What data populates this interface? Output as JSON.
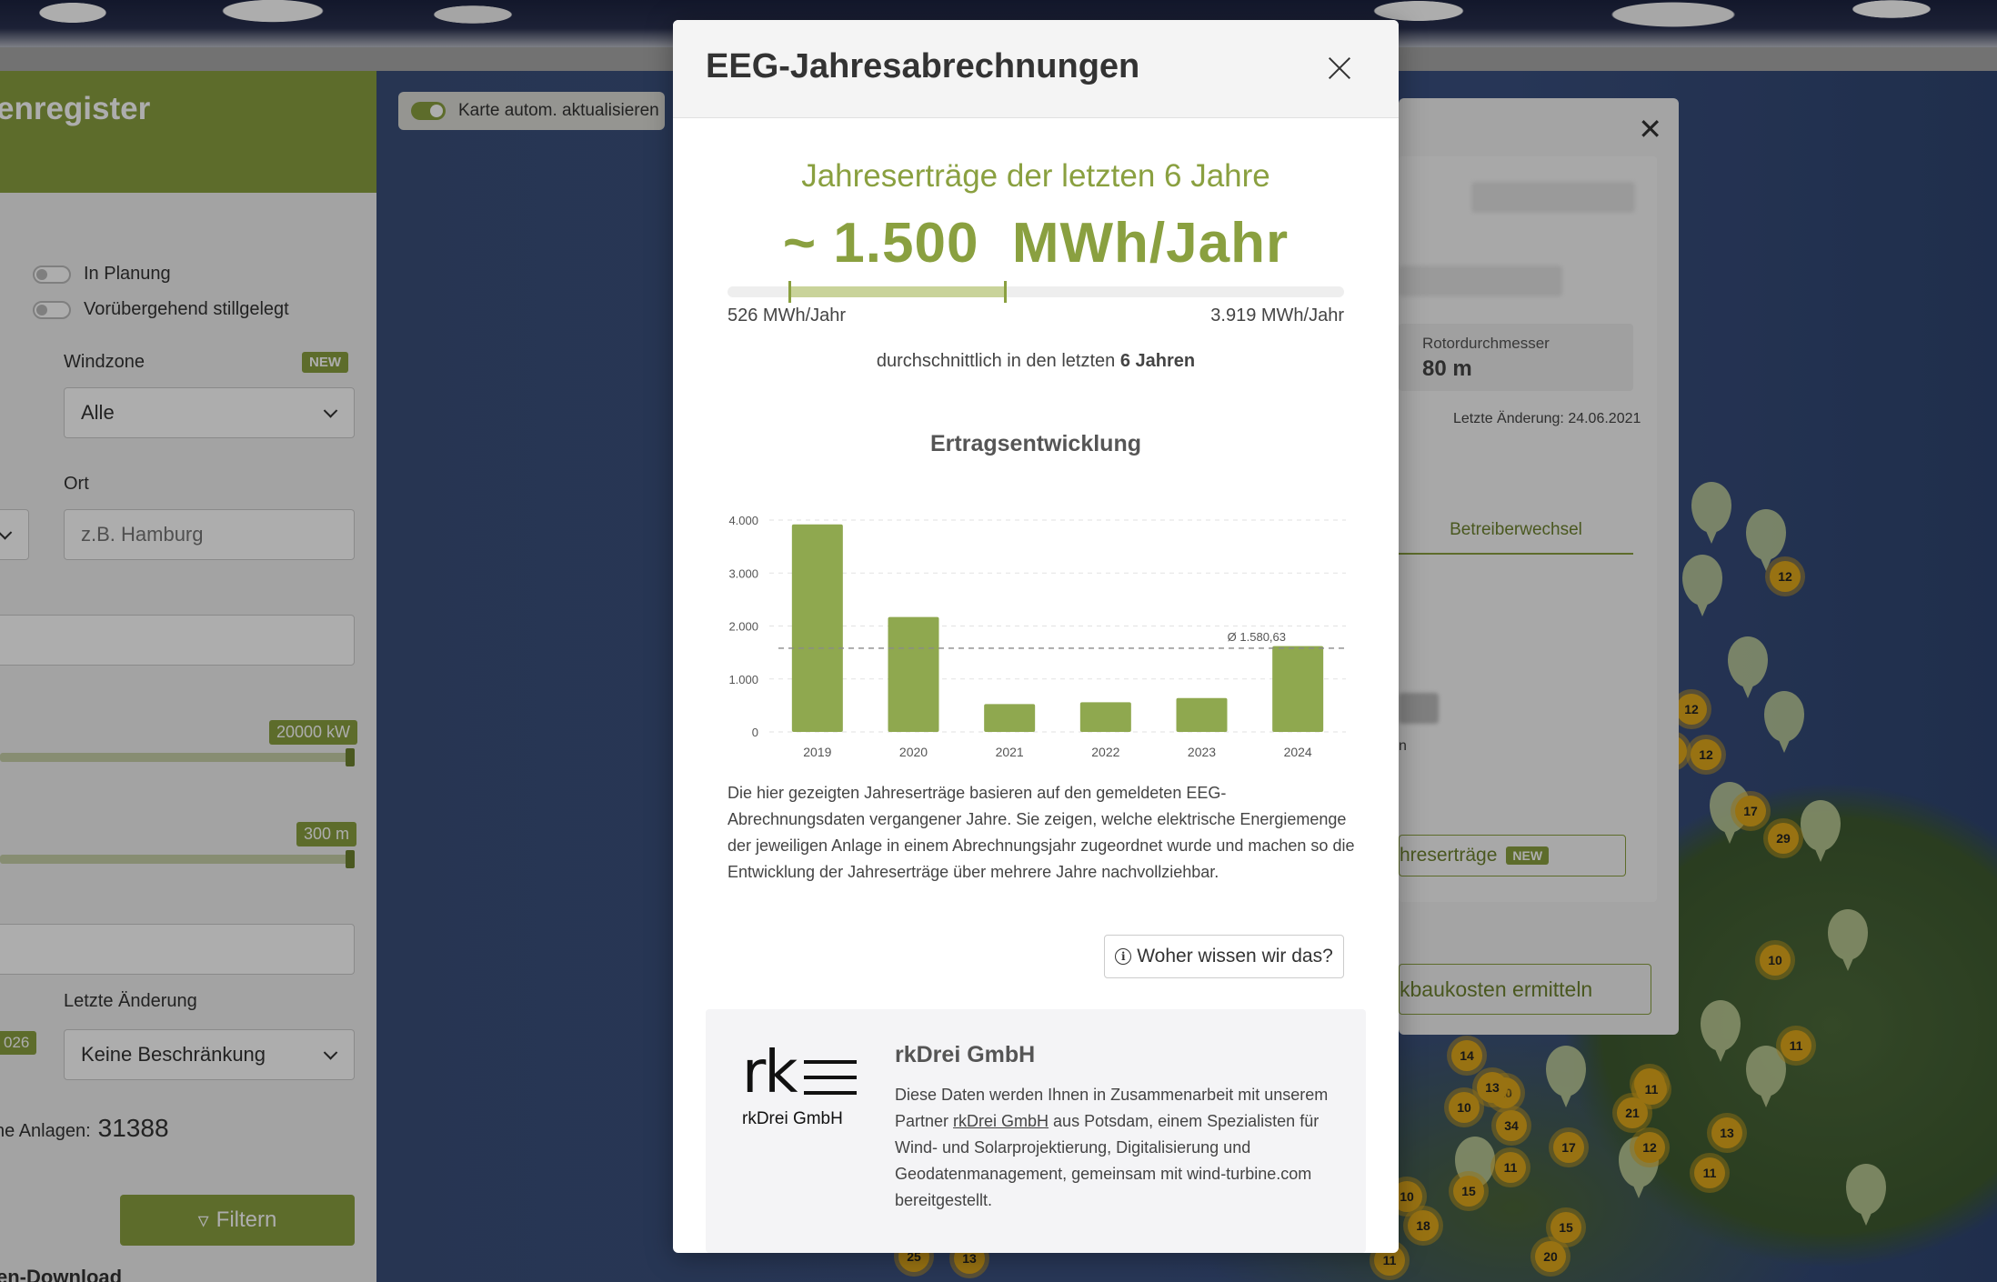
{
  "sidebar": {
    "title": "enregister",
    "toggles": [
      "In Planung",
      "Vorübergehend stillgelegt"
    ],
    "windzone_label": "Windzone",
    "new_badge": "NEW",
    "windzone_value": "Alle",
    "ort_label": "Ort",
    "ort_placeholder": "z.B. Hamburg",
    "power_max": "20000 kW",
    "height_max": "300 m",
    "year_fragment": "026",
    "last_change_label": "Letzte Änderung",
    "last_change_value": "Keine Beschränkung",
    "count_label": "ne Anlagen:",
    "count_value": "31388",
    "filter_button": "Filtern",
    "download_label": "en-Download"
  },
  "map": {
    "auto_update_label": "Karte autom. aktualisieren",
    "clusters": [
      "12",
      "12",
      "13",
      "12",
      "17",
      "29",
      "10",
      "11",
      "14",
      "10",
      "10",
      "13",
      "10",
      "21",
      "11",
      "34",
      "17",
      "12",
      "13",
      "11",
      "11",
      "15",
      "10",
      "18",
      "15",
      "20",
      "11",
      "25",
      "13"
    ]
  },
  "detail_panel": {
    "rotor_label": "Rotordurchmesser",
    "rotor_value": "80 m",
    "last_change": "Letzte Änderung: 24.06.2021",
    "tab_label": "Betreiberwechsel",
    "fragment_n": "n",
    "yield_button": "hreserträge",
    "new_badge": "NEW",
    "cost_button": "kbaukosten ermitteln"
  },
  "modal": {
    "title": "EEG-Jahresabrechnungen",
    "heading": "Jahreserträge der letzten 6 Jahre",
    "value": "~ 1.500  MWh/Jahr",
    "range_min": "526 MWh/Jahr",
    "range_max": "3.919 MWh/Jahr",
    "range_fill": [
      0.1,
      0.45
    ],
    "avg_prefix": "durchschnittlich in den letzten ",
    "avg_bold": "6 Jahren",
    "chart_title": "Ertragsentwicklung",
    "description": "Die hier gezeigten Jahreserträge basieren auf den gemeldeten EEG-Abrechnungsdaten vergangener Jahre. Sie zeigen, welche elektrische Energiemenge der jeweiligen Anlage in einem Abrechnungsjahr zugeordnet wurde und machen so die Entwicklung der Jahreserträge über mehrere Jahre nachvollziehbar.",
    "source_button": "Woher wissen wir das?",
    "partner": {
      "logo_mark": "rk",
      "logo_sub": "rkDrei GmbH",
      "name": "rkDrei GmbH",
      "text_before": "Diese Daten werden Ihnen in Zusammenarbeit mit unserem Partner ",
      "link": "rkDrei GmbH",
      "text_after": " aus Potsdam, einem Spezialisten für Wind- und Solarprojektierung, Digitalisierung und Geodatenmanagement, gemeinsam mit wind-turbine.com bereitgestellt."
    }
  },
  "chart_data": {
    "type": "bar",
    "title": "Ertragsentwicklung",
    "categories": [
      "2019",
      "2020",
      "2021",
      "2022",
      "2023",
      "2024"
    ],
    "values": [
      3919,
      2170,
      526,
      560,
      640,
      1620
    ],
    "ylim": [
      0,
      4000
    ],
    "yticks": [
      0,
      1000,
      2000,
      3000,
      4000
    ],
    "ytick_labels": [
      "0",
      "1.000",
      "2.000",
      "3.000",
      "4.000"
    ],
    "average": 1580.63,
    "average_label": "Ø 1.580,63",
    "grid": true,
    "bar_color": "#8fa84f"
  },
  "colors": {
    "accent": "#8aa040",
    "cluster": "#e0a91b"
  }
}
